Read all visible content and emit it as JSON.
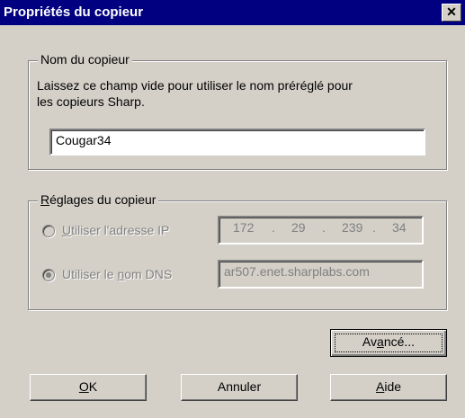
{
  "dialog": {
    "title": "Propriétés du copieur",
    "close_glyph": "✕"
  },
  "name_group": {
    "legend": "Nom du copieur",
    "description_line1": "Laissez ce champ vide pour utiliser le nom préréglé pour",
    "description_line2": "les copieurs Sharp.",
    "name_value": "Cougar34"
  },
  "settings_group": {
    "legend_prefix": "",
    "legend_mnemonic": "R",
    "legend_rest": "églages du copieur",
    "ip_option": {
      "mnemonic": "U",
      "rest": "tiliser l'adresse IP",
      "selected": false
    },
    "ip_address": [
      "172",
      "29",
      "239",
      "34"
    ],
    "ip_separator": ".",
    "dns_option": {
      "before": "Utiliser le ",
      "mnemonic": "n",
      "rest": "om DNS",
      "selected": true
    },
    "dns_value": "ar507.enet.sharplabs.com"
  },
  "buttons": {
    "advanced": {
      "before": "Av",
      "mnemonic": "a",
      "after": "ncé..."
    },
    "ok": {
      "mnemonic": "O",
      "after": "K"
    },
    "cancel": {
      "label": "Annuler"
    },
    "help": {
      "mnemonic": "A",
      "after": "ide"
    }
  }
}
